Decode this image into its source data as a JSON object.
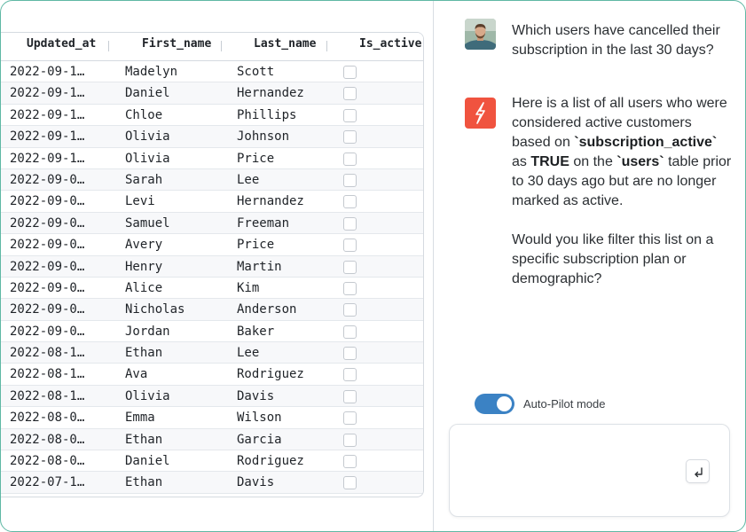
{
  "table": {
    "columns": [
      "Updated_at",
      "First_name",
      "Last_name",
      "Is_active"
    ],
    "rows": [
      {
        "updated_at": "2022-09-1…",
        "first_name": "Madelyn",
        "last_name": "Scott",
        "is_active": false
      },
      {
        "updated_at": "2022-09-1…",
        "first_name": "Daniel",
        "last_name": "Hernandez",
        "is_active": false
      },
      {
        "updated_at": "2022-09-1…",
        "first_name": "Chloe",
        "last_name": "Phillips",
        "is_active": false
      },
      {
        "updated_at": "2022-09-1…",
        "first_name": "Olivia",
        "last_name": "Johnson",
        "is_active": false
      },
      {
        "updated_at": "2022-09-1…",
        "first_name": "Olivia",
        "last_name": "Price",
        "is_active": false
      },
      {
        "updated_at": "2022-09-0…",
        "first_name": "Sarah",
        "last_name": "Lee",
        "is_active": false
      },
      {
        "updated_at": "2022-09-0…",
        "first_name": "Levi",
        "last_name": "Hernandez",
        "is_active": false
      },
      {
        "updated_at": "2022-09-0…",
        "first_name": "Samuel",
        "last_name": "Freeman",
        "is_active": false
      },
      {
        "updated_at": "2022-09-0…",
        "first_name": "Avery",
        "last_name": "Price",
        "is_active": false
      },
      {
        "updated_at": "2022-09-0…",
        "first_name": "Henry",
        "last_name": "Martin",
        "is_active": false
      },
      {
        "updated_at": "2022-09-0…",
        "first_name": "Alice",
        "last_name": "Kim",
        "is_active": false
      },
      {
        "updated_at": "2022-09-0…",
        "first_name": "Nicholas",
        "last_name": "Anderson",
        "is_active": false
      },
      {
        "updated_at": "2022-09-0…",
        "first_name": "Jordan",
        "last_name": "Baker",
        "is_active": false
      },
      {
        "updated_at": "2022-08-1…",
        "first_name": "Ethan",
        "last_name": "Lee",
        "is_active": false
      },
      {
        "updated_at": "2022-08-1…",
        "first_name": "Ava",
        "last_name": "Rodriguez",
        "is_active": false
      },
      {
        "updated_at": "2022-08-1…",
        "first_name": "Olivia",
        "last_name": "Davis",
        "is_active": false
      },
      {
        "updated_at": "2022-08-0…",
        "first_name": "Emma",
        "last_name": "Wilson",
        "is_active": false
      },
      {
        "updated_at": "2022-08-0…",
        "first_name": "Ethan",
        "last_name": "Garcia",
        "is_active": false
      },
      {
        "updated_at": "2022-08-0…",
        "first_name": "Daniel",
        "last_name": "Rodriguez",
        "is_active": false
      },
      {
        "updated_at": "2022-07-1…",
        "first_name": "Ethan",
        "last_name": "Davis",
        "is_active": false
      }
    ]
  },
  "chat": {
    "user_message": "Which users have cancelled their subscription in the last 30 days?",
    "assistant": {
      "p1_a": "Here is a list of all users who were considered active customers based on ",
      "p1_field": "`subscription_active`",
      "p1_b": " as ",
      "p1_value": "TRUE",
      "p1_c": " on the ",
      "p1_table": "`users`",
      "p1_d": " table prior to 30 days ago but are no longer marked as active.",
      "p2": "Would you like filter this list on a specific subscription plan or demographic?"
    }
  },
  "autopilot": {
    "label": "Auto-Pilot mode",
    "enabled": true
  },
  "composer": {
    "placeholder": "",
    "value": ""
  },
  "icons": {
    "avatar": "user-avatar",
    "assistant": "lightning-bolt-icon",
    "send": "enter-return-icon"
  },
  "colors": {
    "frame_border": "#5fb8a4",
    "assistant_icon_bg": "#f0533f",
    "toggle_on": "#3b82c4"
  }
}
